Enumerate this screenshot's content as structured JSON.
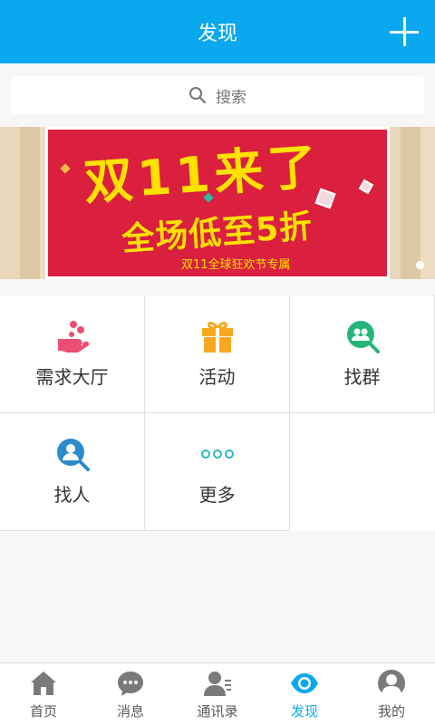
{
  "header": {
    "title": "发现",
    "plus_icon": "plus-icon"
  },
  "search": {
    "placeholder": "搜索",
    "icon": "search-icon"
  },
  "banner": {
    "headline": "双11来了",
    "subheadline": "全场低至5折",
    "tagline": "双11全球狂欢节专属",
    "colors": {
      "background": "#da1f3f",
      "text": "#ffe100"
    }
  },
  "grid": {
    "items": [
      {
        "label": "需求大厅",
        "icon": "hand-coins-icon",
        "color": "#ec4d73"
      },
      {
        "label": "活动",
        "icon": "gift-icon",
        "color": "#f8a820"
      },
      {
        "label": "找群",
        "icon": "find-group-icon",
        "color": "#24b57a"
      },
      {
        "label": "找人",
        "icon": "find-person-icon",
        "color": "#2b8ccc"
      },
      {
        "label": "更多",
        "icon": "more-dots-icon",
        "color": "#2ab8c5"
      }
    ]
  },
  "nav": {
    "items": [
      {
        "label": "首页",
        "icon": "home-icon",
        "active": false
      },
      {
        "label": "消息",
        "icon": "message-icon",
        "active": false
      },
      {
        "label": "通讯录",
        "icon": "contacts-icon",
        "active": false
      },
      {
        "label": "发现",
        "icon": "eye-icon",
        "active": true
      },
      {
        "label": "我的",
        "icon": "profile-icon",
        "active": false
      }
    ]
  },
  "colors": {
    "accent": "#0aa8ee",
    "nav_inactive": "#7a7a7a"
  }
}
